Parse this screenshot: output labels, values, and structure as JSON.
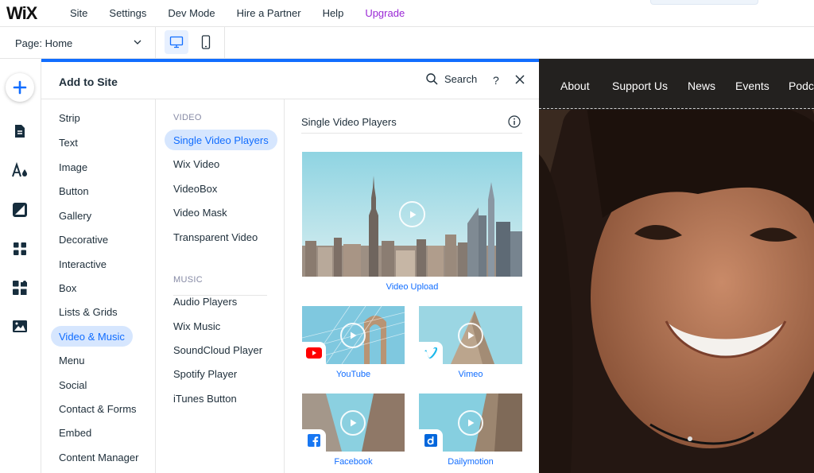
{
  "topbar": {
    "logo": "WiX",
    "menu": [
      "Site",
      "Settings",
      "Dev Mode",
      "Hire a Partner",
      "Help"
    ],
    "upgrade": "Upgrade"
  },
  "secondbar": {
    "page_label": "Page: Home",
    "devices": [
      "desktop-icon",
      "mobile-icon"
    ]
  },
  "leftrail": {
    "icons": [
      "plus-icon",
      "pages-icon",
      "design-icon",
      "background-icon",
      "apps-icon",
      "puzzle-icon",
      "media-icon"
    ]
  },
  "panel": {
    "title": "Add to Site",
    "search_label": "Search",
    "help": "?",
    "categories": [
      "Strip",
      "Text",
      "Image",
      "Button",
      "Gallery",
      "Decorative",
      "Interactive",
      "Box",
      "Lists & Grids",
      "Video & Music",
      "Menu",
      "Social",
      "Contact & Forms",
      "Embed",
      "Content Manager"
    ],
    "active_category": "Video & Music",
    "video_section": "VIDEO",
    "video_items": [
      "Single Video Players",
      "Wix Video",
      "VideoBox",
      "Video Mask",
      "Transparent Video"
    ],
    "active_sub": "Single Video Players",
    "music_section": "MUSIC",
    "music_items": [
      "Audio Players",
      "Wix Music",
      "SoundCloud Player",
      "Spotify Player",
      "iTunes Button"
    ],
    "content_title": "Single Video Players",
    "thumbs": {
      "upload": "Video Upload",
      "youtube": "YouTube",
      "vimeo": "Vimeo",
      "facebook": "Facebook",
      "dailymotion": "Dailymotion"
    }
  },
  "preview": {
    "nav": [
      "About",
      "Support Us",
      "News",
      "Events",
      "Podc"
    ]
  },
  "colors": {
    "accent": "#116dff",
    "upgrade": "#9a27d5",
    "youtube": "#ff0000",
    "vimeo": "#1ab7ea",
    "facebook": "#1877f2",
    "dailymotion": "#0066dc"
  }
}
